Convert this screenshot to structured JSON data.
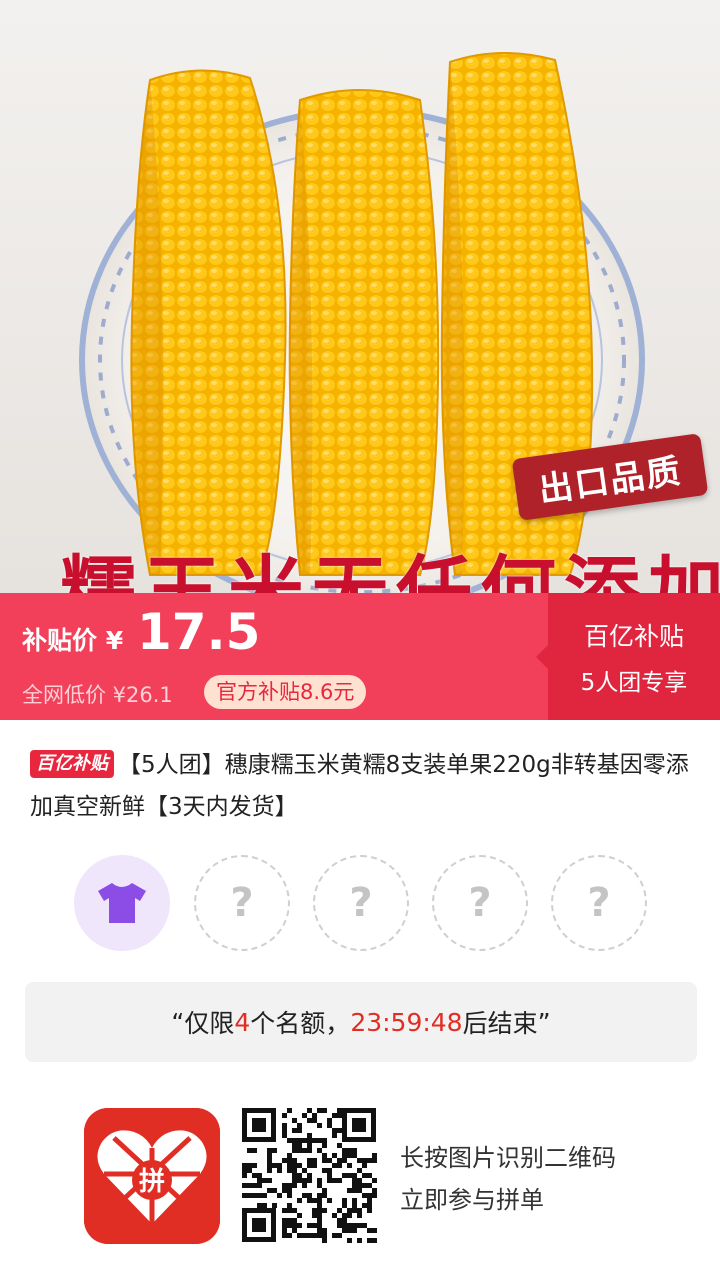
{
  "hero": {
    "badge": "出口品质",
    "caption": "糯玉米无任何添加"
  },
  "price": {
    "subsidy_label": "补贴价 ¥",
    "subsidy_price": "17.5",
    "market_price": "全网低价 ¥26.1",
    "official_subsidy": "官方补贴8.6元",
    "right_line1": "百亿补贴",
    "right_line2": "5人团专享"
  },
  "product": {
    "tag": "百亿补贴",
    "title": "【5人团】穗康糯玉米黄糯8支装单果220g非转基因零添加真空新鲜【3天内发货】"
  },
  "group": {
    "empty_slot_symbol": "?",
    "filled_icon": "tshirt-icon"
  },
  "notice": {
    "open_quote": "“",
    "prefix": "仅限",
    "count": "4",
    "middle": "个名额，",
    "time": "23:59:48",
    "suffix": "后结束",
    "close_quote": "”"
  },
  "bottom": {
    "logo_char": "拼",
    "hint_line1": "长按图片识别二维码",
    "hint_line2": "立即参与拼单"
  },
  "colors": {
    "brand_red": "#e02e24",
    "band_red": "#f2405a",
    "band_dark": "#e0253f"
  }
}
